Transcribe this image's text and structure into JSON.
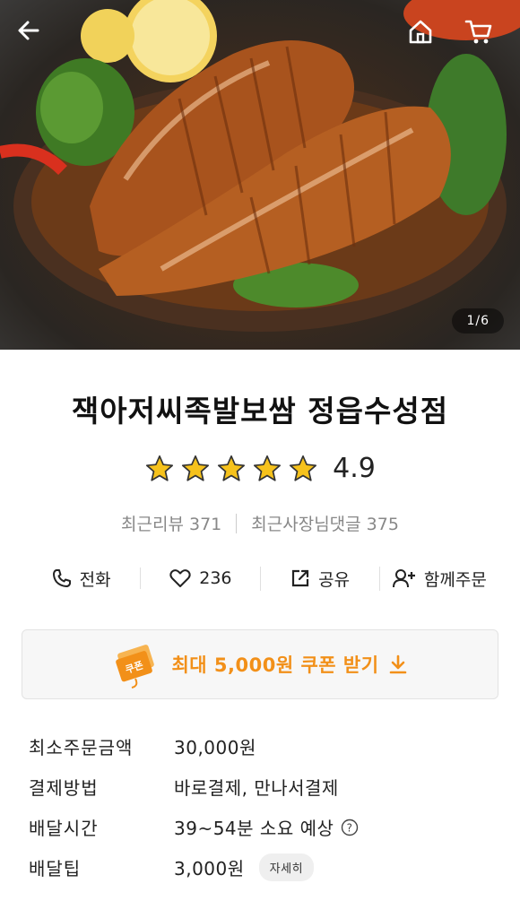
{
  "header": {
    "photo_counter": "1/6",
    "back_icon": "back-arrow-icon",
    "home_icon": "home-icon",
    "cart_icon": "cart-icon"
  },
  "store": {
    "name": "잭아저씨족발보쌈 정읍수성점",
    "rating": "4.9",
    "stars": 5,
    "recent_reviews": "최근리뷰 371",
    "owner_replies": "최근사장님댓글 375"
  },
  "actions": {
    "call_label": "전화",
    "like_count": "236",
    "share_label": "공유",
    "group_order_label": "함께주문"
  },
  "coupon": {
    "badge_text": "쿠폰",
    "label": "최대 5,000원 쿠폰 받기"
  },
  "info": {
    "min_order_key": "최소주문금액",
    "min_order_value": "30,000원",
    "payment_key": "결제방법",
    "payment_value": "바로결제, 만나서결제",
    "delivery_time_key": "배달시간",
    "delivery_time_value": "39~54분 소요 예상",
    "delivery_tip_key": "배달팁",
    "delivery_tip_value": "3,000원",
    "detail_button": "자세히"
  },
  "colors": {
    "accent": "#f29019",
    "star": "#f6c21c"
  }
}
